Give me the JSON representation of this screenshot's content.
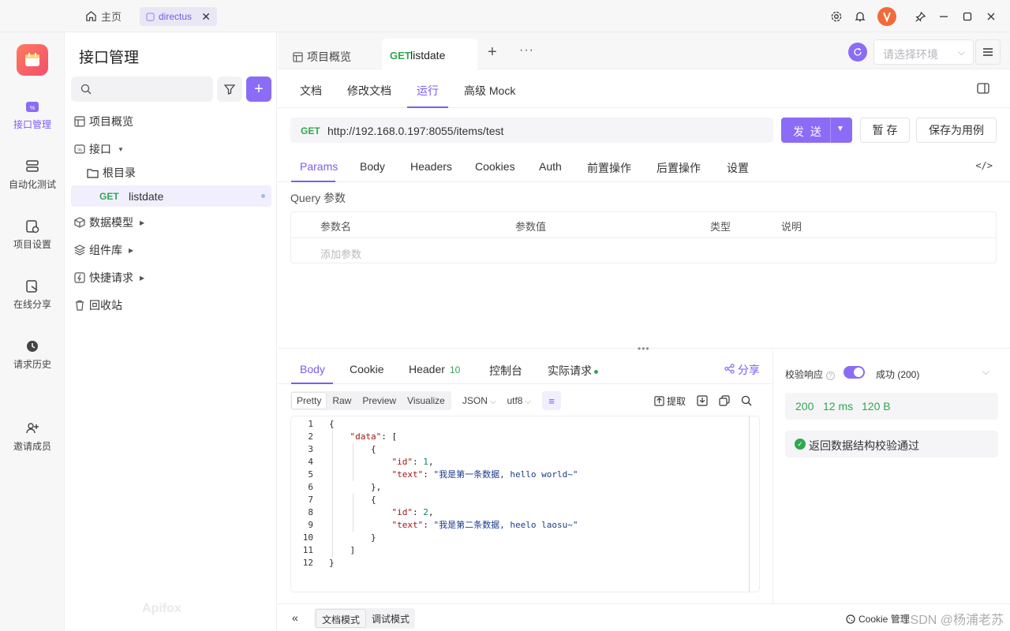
{
  "titlebar": {
    "home_label": "主页",
    "tab_label": "directus",
    "tab_close": "✕"
  },
  "rail": {
    "items": [
      {
        "label": "接口管理"
      },
      {
        "label": "自动化测试"
      },
      {
        "label": "项目设置"
      },
      {
        "label": "在线分享"
      },
      {
        "label": "请求历史"
      },
      {
        "label": "邀请成员"
      }
    ]
  },
  "sidebar": {
    "title": "接口管理",
    "search_placeholder": "",
    "tree": {
      "overview": "项目概览",
      "api": "接口",
      "root": "根目录",
      "active_method": "GET",
      "active_name": "listdate",
      "models": "数据模型",
      "components": "组件库",
      "quick": "快捷请求",
      "trash": "回收站"
    },
    "watermark": "Apifox"
  },
  "main_tabs": {
    "overview": "项目概览",
    "active_method": "GET",
    "active_name": "listdate",
    "plus": "+",
    "more": "···",
    "env_placeholder": "请选择环境"
  },
  "subtabs": [
    "文档",
    "修改文档",
    "运行",
    "高级 Mock"
  ],
  "request": {
    "method": "GET",
    "url": "http://192.168.0.197:8055/items/test",
    "send": "发 送",
    "save": "暂 存",
    "save_case": "保存为用例"
  },
  "param_tabs": [
    "Params",
    "Body",
    "Headers",
    "Cookies",
    "Auth",
    "前置操作",
    "后置操作",
    "设置"
  ],
  "params": {
    "section_label": "Query 参数",
    "headers": [
      "参数名",
      "参数值",
      "类型",
      "说明"
    ],
    "add_placeholder": "添加参数"
  },
  "response": {
    "tabs": [
      {
        "label": "Body"
      },
      {
        "label": "Cookie"
      },
      {
        "label": "Header",
        "count": "10"
      },
      {
        "label": "控制台"
      },
      {
        "label": "实际请求"
      }
    ],
    "share": "分享",
    "formats": [
      "Pretty",
      "Raw",
      "Preview",
      "Visualize"
    ],
    "lang": "JSON",
    "encoding": "utf8",
    "extract": "提取",
    "code": [
      "{",
      "    \"data\": [",
      "        {",
      "            \"id\": 1,",
      "            \"text\": \"我是第一条数据, hello world~\"",
      "        },",
      "        {",
      "            \"id\": 2,",
      "            \"text\": \"我是第二条数据, heelo laosu~\"",
      "        }",
      "    ]",
      "}"
    ]
  },
  "validation": {
    "label": "校验响应",
    "help": "?",
    "status": "成功 (200)",
    "code": "200",
    "time": "12 ms",
    "size": "120 B",
    "result": "返回数据结构校验通过"
  },
  "statusbar": {
    "doc_mode": "文档模式",
    "debug_mode": "调试模式",
    "cookie_manager": "Cookie 管理",
    "watermark": "CSDN @杨浦老苏"
  },
  "colors": {
    "accent": "#8b6cf6",
    "get_green": "#2fa84f"
  }
}
